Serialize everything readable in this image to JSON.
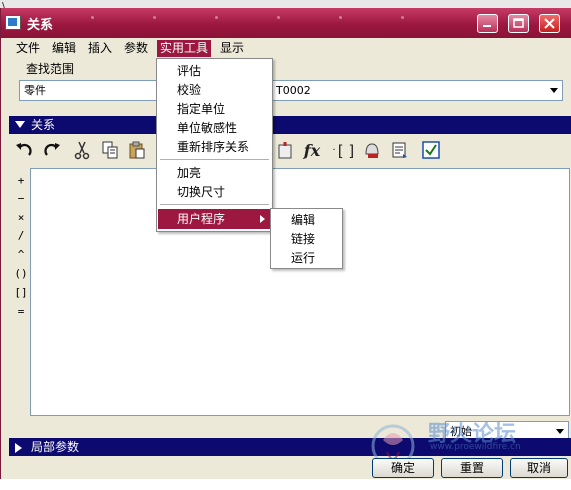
{
  "background": {
    "fragment_left": "\\",
    "fragment_right": "_"
  },
  "window": {
    "title": "关系",
    "title_color": "#9c1840",
    "controls": [
      "minimize",
      "maximize",
      "close"
    ]
  },
  "menubar": {
    "items": [
      "文件",
      "编辑",
      "插入",
      "参数",
      "实用工具",
      "显示"
    ],
    "active": "实用工具"
  },
  "scope": {
    "label": "查找范围",
    "type_value": "零件",
    "model_value": "T0002"
  },
  "relations_section": {
    "title": "关系"
  },
  "toolbar": {
    "icons": [
      "undo-icon",
      "redo-icon",
      "cut-icon",
      "copy-icon",
      "paste-icon",
      "verify-icon",
      "function-icon",
      "brackets-icon",
      "evaluate-icon",
      "sort-icon",
      "check-icon"
    ],
    "fx_label": "fx",
    "brackets_label": "[ ]"
  },
  "operators": [
    "+",
    "−",
    "×",
    "/",
    "^",
    "()",
    "[]",
    "="
  ],
  "editor": {
    "content": ""
  },
  "state_select": {
    "value": "初始"
  },
  "local_params_section": {
    "title": "局部参数"
  },
  "buttons": {
    "ok": "确定",
    "reset": "重置",
    "cancel": "取消"
  },
  "utility_menu": {
    "items": [
      "评估",
      "校验",
      "指定单位",
      "单位敏感性",
      "重新排序关系",
      "加亮",
      "切换尺寸",
      "用户程序"
    ],
    "highlighted": "用户程序"
  },
  "user_program_submenu": {
    "items": [
      "编辑",
      "链接",
      "运行"
    ]
  },
  "watermark": {
    "text": "野火论坛",
    "subtext": "www.proewildfire.cn"
  }
}
